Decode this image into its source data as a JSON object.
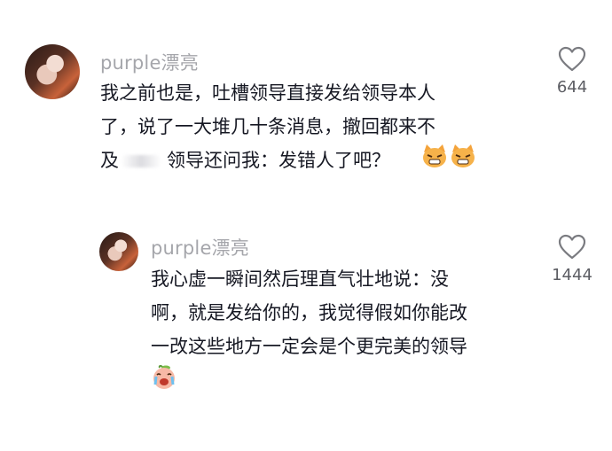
{
  "comments": [
    {
      "username": "purple漂亮",
      "line1": "我之前也是，吐槽领导直接发给领导本人",
      "line2": "了，说了一大堆几十条消息，撤回都来不",
      "line3_before": "及",
      "line3_after": "领导还问我：发错人了吧？",
      "emojis": [
        "angry-cat-emoji",
        "angry-cat-emoji"
      ],
      "like_count": "644",
      "like_icon": "heart-outline-icon"
    },
    {
      "username": "purple漂亮",
      "line1": "我心虚一瞬间然后理直气壮地说：没",
      "line2": "啊，就是发给你的，我觉得假如你能改",
      "line3": "一改这些地方一定会是个更完美的领导",
      "emojis": [
        "crying-peach-emoji"
      ],
      "like_count": "1444",
      "like_icon": "heart-outline-icon"
    }
  ]
}
